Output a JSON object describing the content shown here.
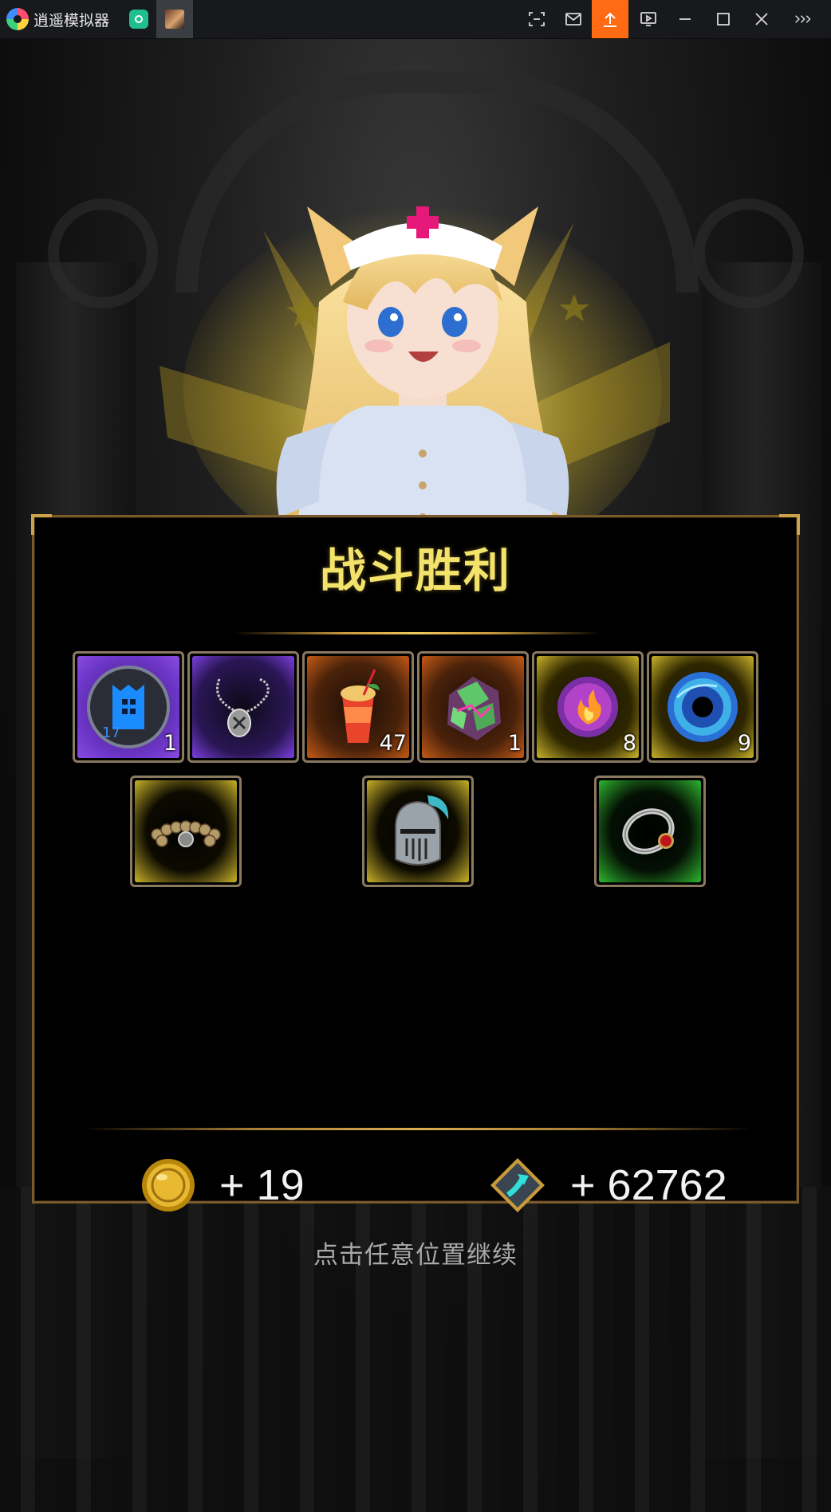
{
  "titlebar": {
    "app_name": "逍遥模拟器",
    "buttons": [
      "screenshot-icon",
      "mail-icon",
      "upload-icon",
      "screen-record-icon",
      "minimize-icon",
      "maximize-icon",
      "close-icon",
      "more-icon"
    ]
  },
  "panel": {
    "title": "战斗胜利",
    "items_row1": [
      {
        "name": "blue-rune",
        "rarity": "purple",
        "count": "1",
        "level": "17"
      },
      {
        "name": "silver-necklace",
        "rarity": "purple",
        "count": ""
      },
      {
        "name": "juice-drink",
        "rarity": "orange",
        "count": "47"
      },
      {
        "name": "green-crystal-ore",
        "rarity": "orange",
        "count": "1"
      },
      {
        "name": "fire-orb",
        "rarity": "yellow",
        "count": "8"
      },
      {
        "name": "blue-vortex-orb",
        "rarity": "yellow",
        "count": "9"
      }
    ],
    "items_row2": [
      {
        "name": "bead-bracelet",
        "rarity": "yellow"
      },
      {
        "name": "knight-helmet",
        "rarity": "yellow"
      },
      {
        "name": "ruby-ring",
        "rarity": "green"
      }
    ],
    "gold_reward": "+ 19",
    "exp_reward": "+ 62762"
  },
  "continue_text": "点击任意位置继续",
  "colors": {
    "title": "#f4e36a",
    "rarity_purple": "#7a3bd6",
    "rarity_orange": "#c45a16",
    "rarity_yellow": "#c9b22a",
    "rarity_green": "#2fb52f",
    "upload_button": "#ff6a12"
  }
}
